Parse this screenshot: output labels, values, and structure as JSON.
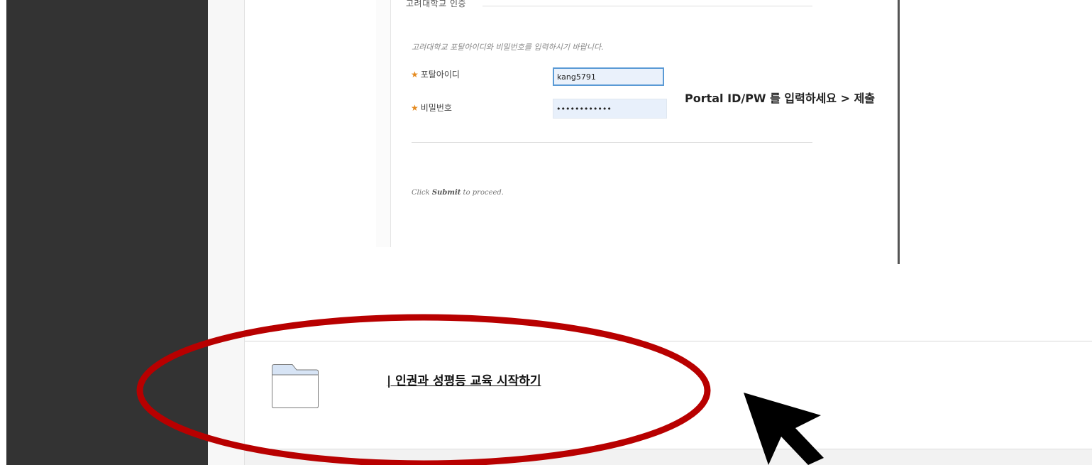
{
  "auth_section": {
    "legend": "고려대학교 인증",
    "instruction": "고려대학교 포탈아이디와 비밀번호를 입력하시기 바랍니다.",
    "required_mark": "★",
    "portal_id_label": "포탈아이디",
    "portal_id_value": "kang5791",
    "password_label": "비밀번호",
    "password_value": "••••••••••••",
    "submit_hint_prefix": "Click ",
    "submit_hint_bold": "Submit",
    "submit_hint_suffix": " to proceed."
  },
  "annotation": {
    "text": "Portal ID/PW 를 입력하세요 > 제출"
  },
  "content_list": {
    "item_link": "| 인권과 성평등 교육 시작하기",
    "item_icon": "folder-icon"
  },
  "colors": {
    "sidebar": "#333333",
    "highlight_ellipse": "#b80000",
    "required_star": "#e58a1f",
    "input_focus_border": "#5a9ad5"
  }
}
